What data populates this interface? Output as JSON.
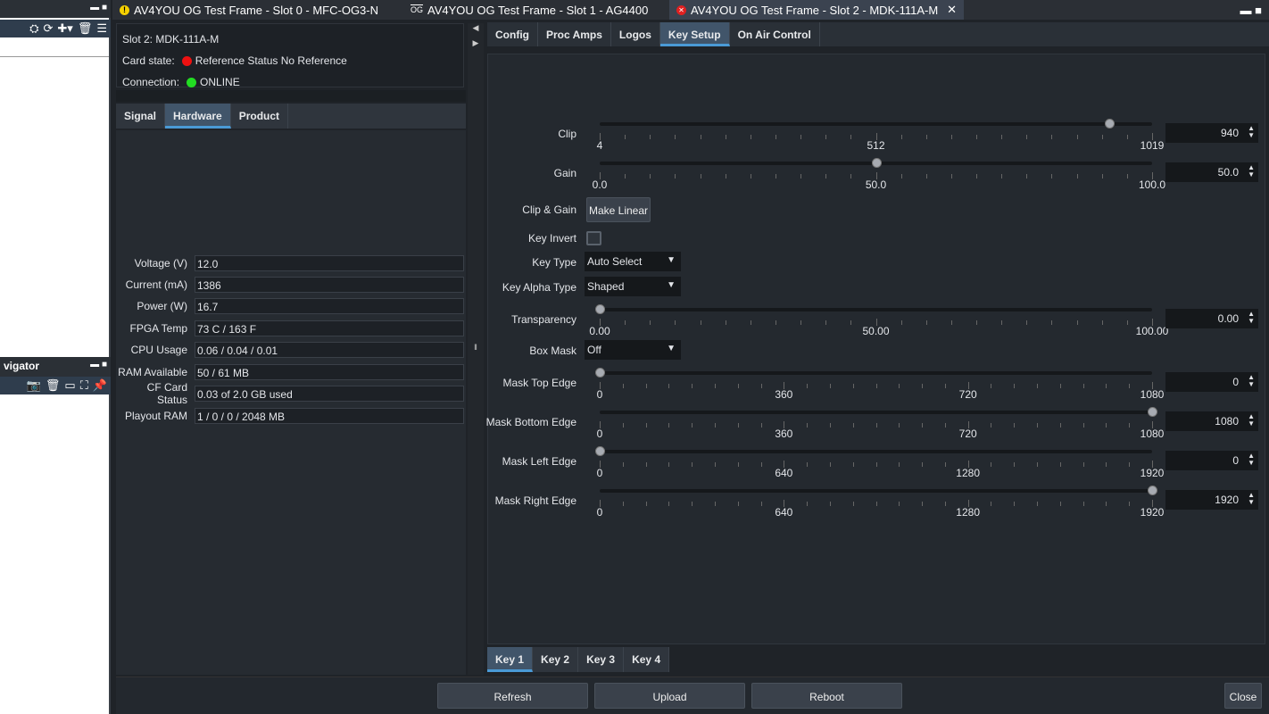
{
  "left_dock": {
    "navigator_title": "vigator"
  },
  "window_tabs": [
    {
      "label": "AV4YOU OG Test Frame - Slot 0 - MFC-OG3-N",
      "status_color": "#f5d000"
    },
    {
      "label": "AV4YOU OG Test Frame - Slot 1 - AG4400"
    },
    {
      "label": "AV4YOU OG Test Frame - Slot 2 - MDK-111A-M",
      "status_color": "#e02020",
      "close": "✕"
    }
  ],
  "card": {
    "slot": "Slot 2: MDK-111A-M",
    "state_label": "Card state:",
    "state_value": "Reference Status No Reference",
    "state_color": "#ee1111",
    "conn_label": "Connection:",
    "conn_value": "ONLINE",
    "conn_color": "#22dd22"
  },
  "left_tabs": [
    "Signal",
    "Hardware",
    "Product"
  ],
  "hardware": [
    {
      "label": "Voltage (V)",
      "value": "12.0"
    },
    {
      "label": "Current (mA)",
      "value": "1386"
    },
    {
      "label": "Power (W)",
      "value": "16.7"
    },
    {
      "label": "FPGA Temp",
      "value": "73 C / 163 F"
    },
    {
      "label": "CPU Usage",
      "value": "0.06 / 0.04 / 0.01"
    },
    {
      "label": "RAM Available",
      "value": "50 / 61 MB"
    },
    {
      "label": "CF Card Status",
      "value": "0.03 of 2.0 GB used"
    },
    {
      "label": "Playout RAM",
      "value": "1 / 0 / 0 / 2048 MB"
    }
  ],
  "right_tabs": [
    "Config",
    "Proc Amps",
    "Logos",
    "Key Setup",
    "On Air Control"
  ],
  "key_setup": {
    "sliders": [
      {
        "label": "Clip",
        "value": 940,
        "min": 4,
        "max": 1019,
        "display": "940",
        "ticks": [
          "4",
          "512",
          "1019"
        ]
      },
      {
        "label": "Gain",
        "value": 50,
        "min": 0,
        "max": 100,
        "display": "50.0",
        "ticks": [
          "0.0",
          "50.0",
          "100.0"
        ]
      },
      {
        "label": "Transparency",
        "value": 0,
        "min": 0,
        "max": 100,
        "display": "0.00",
        "ticks": [
          "0.00",
          "50.00",
          "100.00"
        ]
      },
      {
        "label": "Mask Top Edge",
        "value": 0,
        "min": 0,
        "max": 1080,
        "display": "0",
        "ticks": [
          "0",
          "360",
          "720",
          "1080"
        ]
      },
      {
        "label": "Mask Bottom Edge",
        "value": 1080,
        "min": 0,
        "max": 1080,
        "display": "1080",
        "ticks": [
          "0",
          "360",
          "720",
          "1080"
        ]
      },
      {
        "label": "Mask Left Edge",
        "value": 0,
        "min": 0,
        "max": 1920,
        "display": "0",
        "ticks": [
          "0",
          "640",
          "1280",
          "1920"
        ]
      },
      {
        "label": "Mask Right Edge",
        "value": 1920,
        "min": 0,
        "max": 1920,
        "display": "1920",
        "ticks": [
          "0",
          "640",
          "1280",
          "1920"
        ]
      }
    ],
    "clip_gain_label": "Clip & Gain",
    "make_linear": "Make Linear",
    "key_invert_label": "Key Invert",
    "key_type_label": "Key Type",
    "key_type": "Auto Select",
    "key_alpha_label": "Key Alpha Type",
    "key_alpha": "Shaped",
    "box_mask_label": "Box Mask",
    "box_mask": "Off"
  },
  "key_tabs": [
    "Key 1",
    "Key 2",
    "Key 3",
    "Key 4"
  ],
  "bottom": {
    "refresh": "Refresh",
    "upload": "Upload",
    "reboot": "Reboot",
    "close": "Close"
  }
}
